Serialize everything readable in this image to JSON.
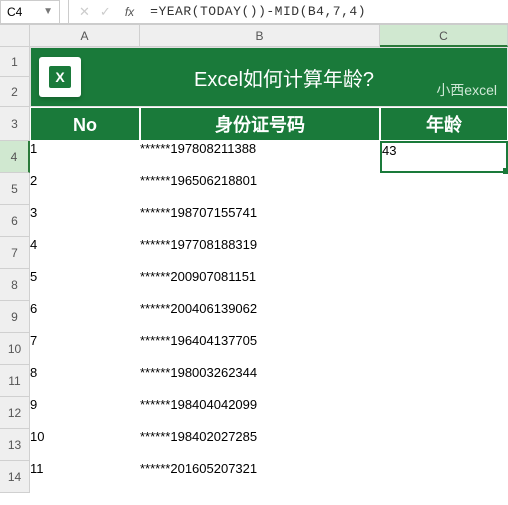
{
  "formula_bar": {
    "name_box": "C4",
    "fx_label": "fx",
    "formula": "=YEAR(TODAY())-MID(B4,7,4)"
  },
  "col_headers": [
    "A",
    "B",
    "C"
  ],
  "row_headers": [
    "1",
    "2",
    "3",
    "4",
    "5",
    "6",
    "7",
    "8",
    "9",
    "10",
    "11",
    "12",
    "13",
    "14"
  ],
  "title": {
    "logo_letter": "X",
    "main": "Excel如何计算年龄?",
    "subtitle": "小西excel"
  },
  "table_headers": {
    "no": "No",
    "id": "身份证号码",
    "age": "年龄"
  },
  "rows": [
    {
      "no": "1",
      "id": "******197808211388",
      "age": "43"
    },
    {
      "no": "2",
      "id": "******196506218801",
      "age": ""
    },
    {
      "no": "3",
      "id": "******198707155741",
      "age": ""
    },
    {
      "no": "4",
      "id": "******197708188319",
      "age": ""
    },
    {
      "no": "5",
      "id": "******200907081151",
      "age": ""
    },
    {
      "no": "6",
      "id": "******200406139062",
      "age": ""
    },
    {
      "no": "7",
      "id": "******196404137705",
      "age": ""
    },
    {
      "no": "8",
      "id": "******198003262344",
      "age": ""
    },
    {
      "no": "9",
      "id": "******198404042099",
      "age": ""
    },
    {
      "no": "10",
      "id": "******198402027285",
      "age": ""
    },
    {
      "no": "11",
      "id": "******201605207321",
      "age": ""
    }
  ],
  "active_cell": {
    "row_index": 0,
    "col": "age"
  },
  "colors": {
    "brand": "#1a7a3a"
  }
}
